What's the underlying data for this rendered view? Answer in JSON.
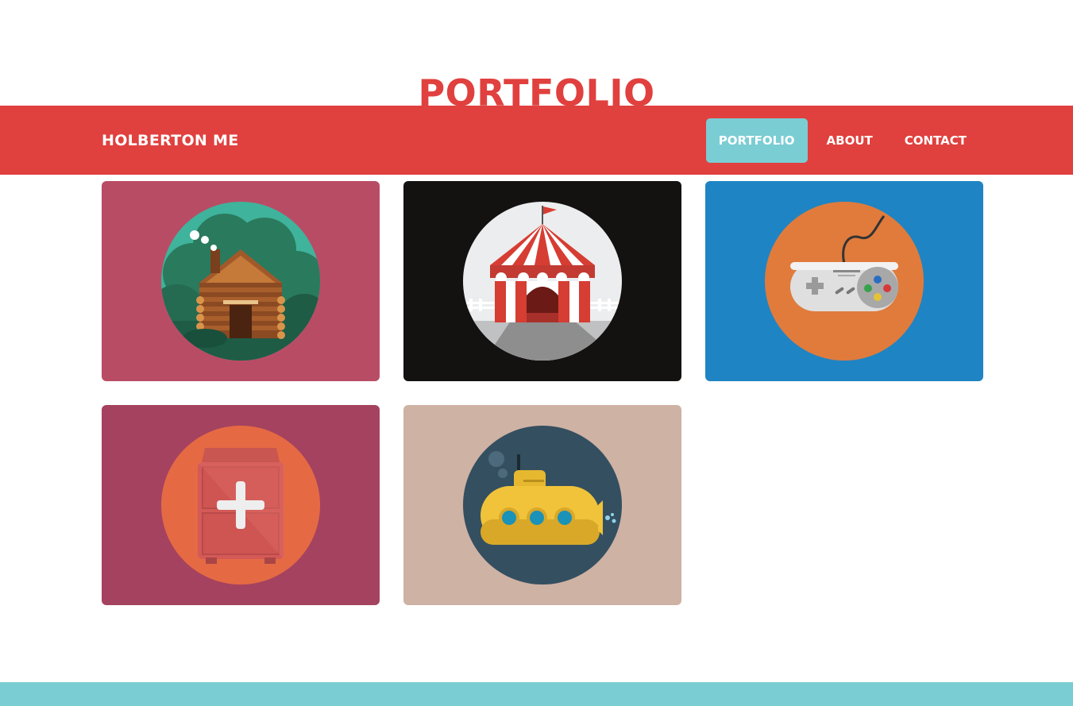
{
  "page": {
    "title": "PORTFOLIO"
  },
  "navbar": {
    "brand": "HOLBERTON ME",
    "items": [
      {
        "label": "PORTFOLIO",
        "active": true
      },
      {
        "label": "ABOUT",
        "active": false
      },
      {
        "label": "CONTACT",
        "active": false
      }
    ]
  },
  "portfolio": {
    "items": [
      {
        "icon": "log-cabin-icon",
        "background": "#b94c65",
        "circle": "#3fb39b"
      },
      {
        "icon": "circus-tent-icon",
        "background": "#141111",
        "circle": "#ecedee"
      },
      {
        "icon": "game-controller-icon",
        "background": "#1f84c3",
        "circle": "#e07b3c"
      },
      {
        "icon": "medicine-cabinet-icon",
        "background": "#a5425f",
        "circle": "#e56a44"
      },
      {
        "icon": "submarine-icon",
        "background": "#ceb2a4",
        "circle": "#344f60"
      }
    ]
  },
  "colors": {
    "accent": "#e0403e",
    "active_nav": "#7acdd3",
    "footer": "#7acdd3"
  }
}
